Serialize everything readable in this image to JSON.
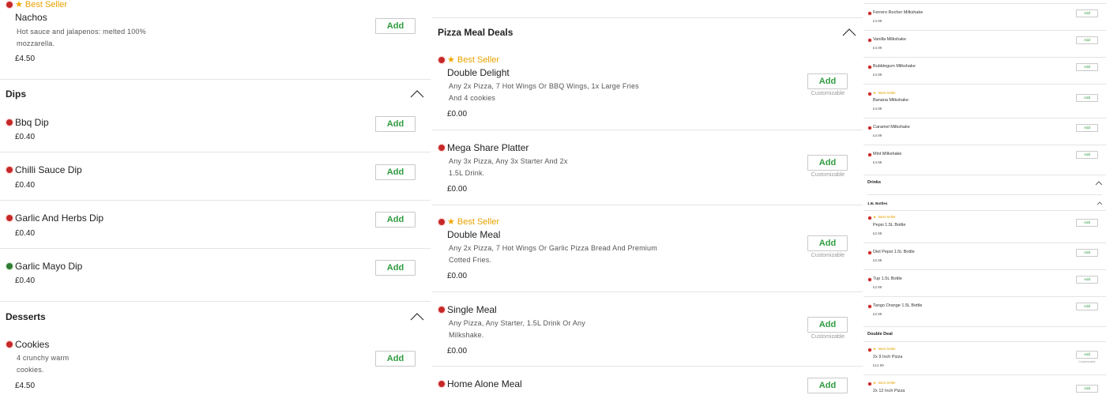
{
  "colors": {
    "accent_green": "#2e9b3e",
    "nonveg_red": "#c62828",
    "veg_green": "#2e7d32",
    "bestseller_gold": "#e8a200"
  },
  "labels": {
    "add": "Add",
    "customizable": "Customizable",
    "best_seller": "Best Seller"
  },
  "col1": {
    "nachos": {
      "name": "Nachos",
      "desc": "Hot sauce and jalapenos: melted 100% mozzarella.",
      "price": "£4.50"
    },
    "dips": {
      "title": "Dips",
      "items": [
        {
          "name": "Bbq Dip",
          "price": "£0.40"
        },
        {
          "name": "Chilli Sauce Dip",
          "price": "£0.40"
        },
        {
          "name": "Garlic And Herbs Dip",
          "price": "£0.40"
        },
        {
          "name": "Garlic Mayo Dip",
          "price": "£0.40"
        }
      ]
    },
    "desserts": {
      "title": "Desserts",
      "items": [
        {
          "name": "Cookies",
          "desc": "4 crunchy warm cookies.",
          "price": "£4.50"
        }
      ]
    }
  },
  "col2": {
    "title": "Pizza Meal Deals",
    "items": [
      {
        "name": "Double Delight",
        "desc": "Any 2x Pizza, 7 Hot Wings Or BBQ Wings, 1x Large Fries And 4 cookies",
        "price": "£0.00"
      },
      {
        "name": "Mega Share Platter",
        "desc": "Any 3x Pizza, Any 3x Starter And 2x 1.5L Drink.",
        "price": "£0.00"
      },
      {
        "name": "Double Meal",
        "desc": "Any 2x Pizza, 7 Hot Wings Or Garlic Pizza Bread And Premium Cotted Fries.",
        "price": "£0.00"
      },
      {
        "name": "Single Meal",
        "desc": "Any Pizza, Any Starter, 1.5L Drink Or Any Milkshake.",
        "price": "£0.00"
      },
      {
        "name": "Home Alone Meal"
      }
    ]
  },
  "col3": {
    "milkshakes": [
      {
        "name": "Ferrero Rocher Milkshake",
        "price": "£4.99"
      },
      {
        "name": "Vanilla Milkshake",
        "price": "£4.99"
      },
      {
        "name": "Bubblegum Milkshake",
        "price": "£4.99"
      },
      {
        "name": "Banana Milkshake",
        "price": "£4.99"
      },
      {
        "name": "Caramel Milkshake",
        "price": "£4.99"
      },
      {
        "name": "Mint Milkshake",
        "price": "£4.99"
      }
    ],
    "drinks_title": "Drinks",
    "bottles_title": "1.5L Bottles",
    "bottles": [
      {
        "name": "Pepsi 1.5L Bottle",
        "price": "£2.99"
      },
      {
        "name": "Diet Pepsi 1.5L Bottle",
        "price": "£2.99"
      },
      {
        "name": "7up 1.5L Bottle",
        "price": "£2.99"
      },
      {
        "name": "Tango Orange 1.5L Bottle",
        "price": "£2.99"
      }
    ],
    "double_deal_title": "Double Deal",
    "double_deal": [
      {
        "name": "2x 9 Inch Pizza",
        "price": "£14.99"
      },
      {
        "name": "2x 12 Inch Pizza"
      }
    ]
  }
}
